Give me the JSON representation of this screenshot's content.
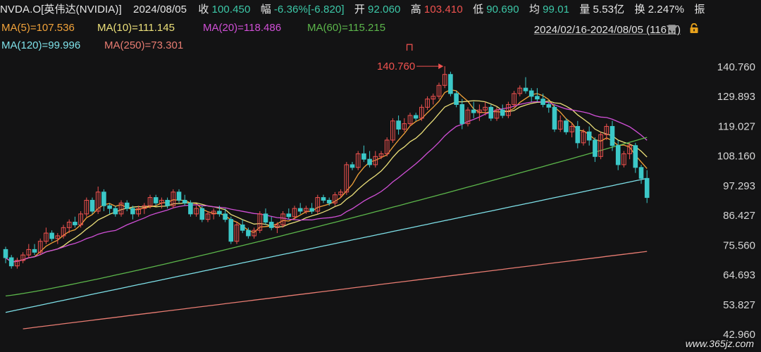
{
  "header": {
    "symbol": "NVDA.O[英伟达(NVIDIA)]",
    "date": "2024/08/05",
    "close_label": "收",
    "close": "100.450",
    "change_label": "幅",
    "change": "-6.36%[-6.820]",
    "open_label": "开",
    "open": "92.060",
    "high_label": "高",
    "high": "103.410",
    "low_label": "低",
    "low": "90.690",
    "avg_label": "均",
    "avg": "99.01",
    "vol_label": "量",
    "vol": "5.53亿",
    "turnover_label": "换",
    "turnover": "2.247%",
    "amp_label": "振"
  },
  "ma_legend": [
    {
      "text": "MA(5)=107.536",
      "color": "#f2a33a"
    },
    {
      "text": "MA(10)=111.145",
      "color": "#ece07a"
    },
    {
      "text": "MA(20)=118.486",
      "color": "#d04fd6"
    },
    {
      "text": "MA(60)=115.215",
      "color": "#5cb64b"
    },
    {
      "text": "MA(120)=99.996",
      "color": "#7ee0e8"
    },
    {
      "text": "MA(250)=73.301",
      "color": "#e87c72"
    }
  ],
  "range_label": "2024/02/16-2024/08/05 (116日)",
  "watermark": "www.365jz.com",
  "chart_data": {
    "type": "candlestick",
    "y_ticks": [
      "140.760",
      "129.893",
      "119.027",
      "108.160",
      "97.293",
      "86.427",
      "75.560",
      "64.693",
      "53.827",
      "42.960"
    ],
    "ylim": [
      42.96,
      140.76
    ],
    "annotation": {
      "text": "140.760",
      "marker": "⊓"
    },
    "up_color": "#f0524f",
    "down_color": "#3cc8c8",
    "candles": [
      [
        74,
        75,
        69,
        71
      ],
      [
        71,
        72,
        67,
        68
      ],
      [
        68,
        71,
        67,
        70
      ],
      [
        70,
        73,
        69,
        72
      ],
      [
        72,
        76,
        71,
        74
      ],
      [
        74,
        76,
        72,
        73
      ],
      [
        73,
        78,
        72,
        77
      ],
      [
        77,
        82,
        76,
        80
      ],
      [
        80,
        81,
        77,
        78
      ],
      [
        78,
        80,
        76,
        79
      ],
      [
        79,
        83,
        78,
        82
      ],
      [
        82,
        85,
        80,
        84
      ],
      [
        84,
        86,
        82,
        83
      ],
      [
        83,
        88,
        82,
        87
      ],
      [
        87,
        93,
        86,
        92
      ],
      [
        92,
        93,
        87,
        88
      ],
      [
        88,
        97,
        87,
        95
      ],
      [
        95,
        96,
        88,
        90
      ],
      [
        90,
        91,
        87,
        89
      ],
      [
        89,
        90,
        86,
        87
      ],
      [
        87,
        92,
        86,
        91
      ],
      [
        91,
        92,
        88,
        89
      ],
      [
        89,
        90,
        85,
        87
      ],
      [
        87,
        90,
        86,
        89
      ],
      [
        89,
        91,
        87,
        90
      ],
      [
        90,
        94,
        89,
        93
      ],
      [
        93,
        94,
        90,
        91
      ],
      [
        91,
        93,
        89,
        92
      ],
      [
        92,
        93,
        89,
        90
      ],
      [
        90,
        96,
        89,
        95
      ],
      [
        95,
        96,
        91,
        92
      ],
      [
        92,
        94,
        90,
        91
      ],
      [
        91,
        92,
        86,
        87
      ],
      [
        87,
        90,
        86,
        89
      ],
      [
        89,
        90,
        84,
        85
      ],
      [
        85,
        88,
        84,
        87
      ],
      [
        87,
        89,
        85,
        88
      ],
      [
        88,
        90,
        86,
        87
      ],
      [
        87,
        89,
        84,
        85
      ],
      [
        85,
        86,
        76,
        77
      ],
      [
        77,
        84,
        76,
        83
      ],
      [
        83,
        85,
        80,
        81
      ],
      [
        81,
        82,
        78,
        79
      ],
      [
        79,
        82,
        78,
        81
      ],
      [
        81,
        88,
        80,
        87
      ],
      [
        87,
        89,
        83,
        84
      ],
      [
        84,
        86,
        81,
        82
      ],
      [
        82,
        84,
        80,
        83
      ],
      [
        83,
        88,
        82,
        87
      ],
      [
        87,
        89,
        85,
        86
      ],
      [
        86,
        90,
        85,
        89
      ],
      [
        89,
        91,
        87,
        88
      ],
      [
        88,
        90,
        87,
        89
      ],
      [
        89,
        91,
        87,
        88
      ],
      [
        88,
        94,
        87,
        93
      ],
      [
        93,
        94,
        91,
        92
      ],
      [
        92,
        93,
        90,
        91
      ],
      [
        91,
        95,
        90,
        94
      ],
      [
        94,
        96,
        93,
        95
      ],
      [
        95,
        106,
        94,
        105
      ],
      [
        105,
        106,
        103,
        104
      ],
      [
        104,
        110,
        103,
        109
      ],
      [
        109,
        112,
        106,
        107
      ],
      [
        107,
        110,
        104,
        105
      ],
      [
        105,
        110,
        104,
        108
      ],
      [
        108,
        110,
        107,
        109
      ],
      [
        109,
        115,
        108,
        114
      ],
      [
        114,
        122,
        113,
        121
      ],
      [
        121,
        123,
        116,
        118
      ],
      [
        118,
        122,
        117,
        120
      ],
      [
        120,
        124,
        119,
        123
      ],
      [
        123,
        124,
        121,
        122
      ],
      [
        122,
        127,
        121,
        126
      ],
      [
        126,
        130,
        125,
        129
      ],
      [
        129,
        131,
        127,
        130
      ],
      [
        130,
        135,
        129,
        134
      ],
      [
        134,
        141,
        133,
        138
      ],
      [
        138,
        139,
        130,
        131
      ],
      [
        131,
        132,
        126,
        127
      ],
      [
        127,
        129,
        118,
        120
      ],
      [
        120,
        126,
        119,
        125
      ],
      [
        125,
        128,
        122,
        124
      ],
      [
        124,
        127,
        121,
        125
      ],
      [
        125,
        128,
        123,
        126
      ],
      [
        126,
        127,
        121,
        122
      ],
      [
        122,
        126,
        121,
        125
      ],
      [
        125,
        127,
        122,
        123
      ],
      [
        123,
        128,
        122,
        127
      ],
      [
        127,
        132,
        126,
        131
      ],
      [
        131,
        134,
        130,
        133
      ],
      [
        133,
        137,
        131,
        132
      ],
      [
        132,
        133,
        128,
        130
      ],
      [
        130,
        133,
        128,
        129
      ],
      [
        129,
        131,
        126,
        127
      ],
      [
        127,
        128,
        124,
        126
      ],
      [
        126,
        127,
        117,
        118
      ],
      [
        118,
        123,
        117,
        121
      ],
      [
        121,
        122,
        116,
        117
      ],
      [
        117,
        120,
        115,
        119
      ],
      [
        119,
        121,
        111,
        113
      ],
      [
        113,
        118,
        112,
        117
      ],
      [
        117,
        119,
        112,
        114
      ],
      [
        114,
        115,
        106,
        108
      ],
      [
        108,
        117,
        107,
        116
      ],
      [
        116,
        120,
        114,
        119
      ],
      [
        119,
        121,
        110,
        112
      ],
      [
        112,
        114,
        103,
        105
      ],
      [
        105,
        110,
        104,
        109
      ],
      [
        109,
        113,
        107,
        112
      ],
      [
        112,
        113,
        102,
        104
      ],
      [
        104,
        105,
        98,
        100
      ],
      [
        100,
        103,
        91,
        93
      ]
    ],
    "ma_series_order": [
      "MA(5)",
      "MA(10)",
      "MA(20)",
      "MA(60)",
      "MA(120)",
      "MA(250)"
    ]
  }
}
